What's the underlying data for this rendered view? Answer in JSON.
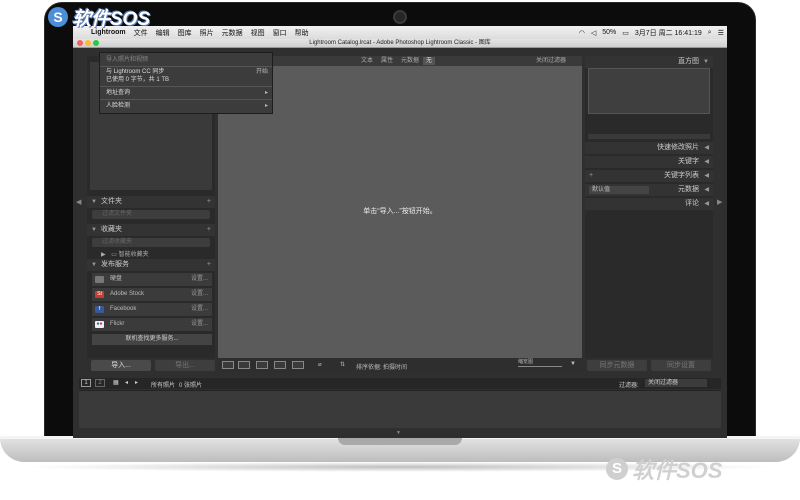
{
  "menubar": {
    "app_name": "Lightroom",
    "items": [
      "文件",
      "编辑",
      "图库",
      "照片",
      "元数据",
      "视图",
      "窗口",
      "帮助"
    ],
    "battery": "50%",
    "datetime": "3月7日 周二  16:41:19"
  },
  "window": {
    "title": "Lightroom Catalog.lrcat - Adobe Photoshop Lightroom Classic - 图库"
  },
  "import_menu": {
    "header": "导入照片和视频",
    "sync_line1": "与 Lightroom CC 同步",
    "sync_action": "开始",
    "sync_line2": "已使用 0 字节，共 1 TB",
    "address_lookup": "地址查询",
    "face_detection": "人脸检测",
    "submenu_arrow": "▸"
  },
  "left_panel": {
    "folders": {
      "label": "文件夹",
      "filter_placeholder": "过滤文件夹"
    },
    "collections": {
      "label": "收藏夹",
      "filter_placeholder": "过滤收藏夹",
      "smart": "智能收藏夹"
    },
    "publish": {
      "label": "发布服务",
      "services": [
        {
          "name": "硬盘",
          "action": "设置..."
        },
        {
          "name": "Adobe Stock",
          "action": "设置..."
        },
        {
          "name": "Facebook",
          "action": "设置..."
        },
        {
          "name": "Flickr",
          "action": "设置..."
        }
      ],
      "find_more": "联机查找更多服务..."
    },
    "import_button": "导入...",
    "export_button": "导出..."
  },
  "center": {
    "filter_tabs": [
      "文本",
      "属性",
      "元数据",
      "无"
    ],
    "filter_preset": "关闭过滤器",
    "empty_prompt": "单击“导入...”按钮开始。",
    "sort_label": "排序依据:",
    "sort_value": "拍摄时间",
    "thumb_label": "缩览图"
  },
  "right_panel": {
    "histogram": "直方图",
    "quick_develop": "快速修改照片",
    "keywording": "关键字",
    "keyword_list": "关键字列表",
    "metadata": "元数据",
    "metadata_preset": "默认值",
    "comments": "评论",
    "sync_metadata": "同步元数据",
    "sync_settings": "同步设置"
  },
  "filmstrip": {
    "page1": "1",
    "page2": "2",
    "source_label": "所有照片",
    "count": "0 张照片",
    "filter_label": "过滤器:",
    "filter_value": "关闭过滤器"
  },
  "watermark": {
    "text": "软件SOS",
    "glyph": "S"
  },
  "icons": {
    "apple": "",
    "triangle_down": "▼",
    "triangle_left": "◀",
    "triangle_right": "▶",
    "plus": "+",
    "back": "◂",
    "forward": "▸",
    "grid": "▦"
  },
  "colors": {
    "adobe_stock": "#c63d2f",
    "facebook": "#3b5998",
    "flickr_pink": "#ff0084",
    "flickr_blue": "#0063dc"
  }
}
